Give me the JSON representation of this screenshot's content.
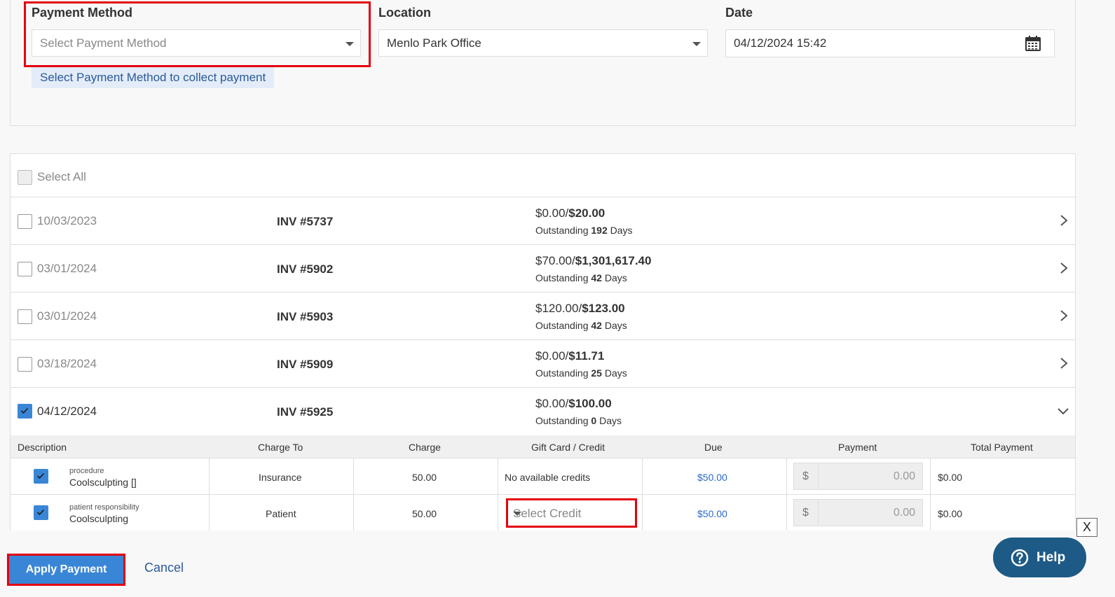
{
  "payment": {
    "method_label": "Payment Method",
    "method_placeholder": "Select Payment Method",
    "location_label": "Location",
    "location_value": "Menlo Park Office",
    "date_label": "Date",
    "date_value": "04/12/2024 15:42",
    "hint": "Select Payment Method to collect payment"
  },
  "list": {
    "select_all": "Select All",
    "invoices": [
      {
        "date": "10/03/2023",
        "number": "INV #5737",
        "paid": "$0.00/",
        "total": "$20.00",
        "outstanding_prefix": "Outstanding ",
        "days": "192",
        "days_suffix": " Days",
        "checked": false
      },
      {
        "date": "03/01/2024",
        "number": "INV #5902",
        "paid": "$70.00/",
        "total": "$1,301,617.40",
        "outstanding_prefix": "Outstanding ",
        "days": "42",
        "days_suffix": " Days",
        "checked": false
      },
      {
        "date": "03/01/2024",
        "number": "INV #5903",
        "paid": "$120.00/",
        "total": "$123.00",
        "outstanding_prefix": "Outstanding ",
        "days": "42",
        "days_suffix": " Days",
        "checked": false
      },
      {
        "date": "03/18/2024",
        "number": "INV #5909",
        "paid": "$0.00/",
        "total": "$11.71",
        "outstanding_prefix": "Outstanding ",
        "days": "25",
        "days_suffix": " Days",
        "checked": false
      },
      {
        "date": "04/12/2024",
        "number": "INV #5925",
        "paid": "$0.00/",
        "total": "$100.00",
        "outstanding_prefix": "Outstanding ",
        "days": "0",
        "days_suffix": " Days",
        "checked": true
      }
    ]
  },
  "detail": {
    "headers": [
      "Description",
      "Charge To",
      "Charge",
      "Gift Card / Credit",
      "Due",
      "Payment",
      "Total Payment"
    ],
    "rows": [
      {
        "type": "procedure",
        "name": "Coolsculpting []",
        "charge_to": "Insurance",
        "charge": "50.00",
        "credit": "No available credits",
        "due": "$50.00",
        "currency": "$",
        "payment": "0.00",
        "total": "$0.00"
      },
      {
        "type": "patient responsibility",
        "name": "Coolsculpting",
        "charge_to": "Patient",
        "charge": "50.00",
        "credit": "Select Credit",
        "due": "$50.00",
        "currency": "$",
        "payment": "0.00",
        "total": "$0.00"
      }
    ]
  },
  "footer": {
    "apply": "Apply Payment",
    "cancel": "Cancel",
    "close": "X",
    "help": "Help"
  },
  "colors": {
    "accent": "#3a86d6",
    "highlight": "#e3000f",
    "help_bg": "#1d5a86"
  }
}
